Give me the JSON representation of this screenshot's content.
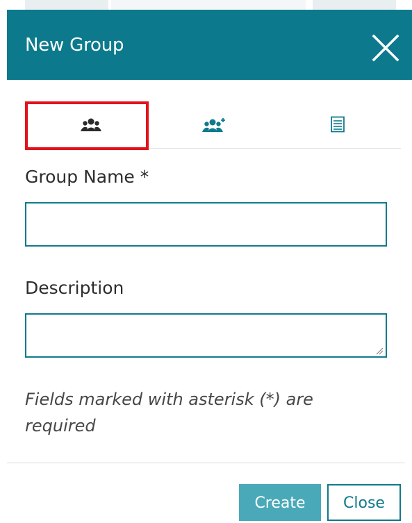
{
  "dialog": {
    "title": "New Group",
    "close_icon": "close-icon"
  },
  "tabs": [
    {
      "icon": "group-icon",
      "active": true
    },
    {
      "icon": "add-members-icon",
      "active": false
    },
    {
      "icon": "list-icon",
      "active": false
    }
  ],
  "form": {
    "group_name_label": "Group Name *",
    "group_name_value": "",
    "description_label": "Description",
    "description_value": "",
    "required_note": "Fields marked with asterisk (*) are required"
  },
  "buttons": {
    "create": "Create",
    "close": "Close"
  },
  "colors": {
    "header": "#0c7a8c",
    "primary_button": "#4aa9b9",
    "highlight": "#e3111b"
  }
}
